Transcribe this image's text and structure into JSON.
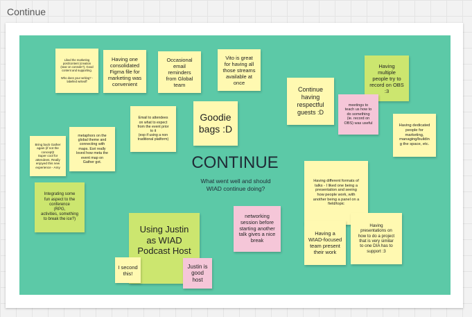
{
  "frame": {
    "title": "Continue"
  },
  "center": {
    "title": "CONTINUE",
    "subtitle": "What went well and should\nWIAD continue doing?"
  },
  "notes": {
    "marketing_post": "Liked the marketing\npost/content (creation\n(sear on console?), Good\ncontent and supporting.\n\nWho does your writing? -\nlabelled writeoff",
    "figma_file": "Having one\nconsolidated\nFigma file for\nmarketing was\nconvenient",
    "email_reminders": "Occasional\nemail\nreminders\nfrom Global\nteam",
    "vito": "Vito is great\nfor having all\nthose streams\navailable at\nonce",
    "record_obs": "Having\nmultiple\npeople try to\nrecord on OBS\n:3",
    "respectful_guests": "Continue\nhaving\nrespectful\nguests :D",
    "meetings_teach": "meetings to\nteach us how to\ndo something\n(ie. record on\nOBS) was useful",
    "email_attendees": "Email to attendees\non what to expect\nfrom the event prior\nto it\n(esp if using a non\ntraditional platform)",
    "goodie_bags": "Goodie\nbags :D",
    "dedicated_people": "Having dedicated\npeople for\nmarketing,\nmanaging/buildin\ng the space, etc.",
    "gather_again": "Bring back Gather\nagain (if not the\nconcept)!\nSuper cool for\nattendees. Really\nenjoyed this new\nexperience - Amy",
    "metaphors": "metaphors on the\nglobal theme and\nconnecting with\nmaps. Esri really\nloved how meta the\nevent map on\nGather got.",
    "fun_aspect": "Integrating some\nfun aspect to the\nconference\n(RPG,\nactivities, something\nto break the ice?)",
    "formats_talks": "Having different formats of\ntalks - I liked one being a\npresentation and seeing\nhow people work, with\nanother being a panel on a\nfield/topic",
    "networking": "networking\nsession before\nstarting another\ntalk gives a nice\nbreak",
    "justin_host": "Using Justin\nas WIAD\nPodcast Host",
    "second_this": "I second\nthis!",
    "justin_good": "Justin is\ngood\nhost",
    "wiad_team": "Having a\nWIAD-focused\nteam present\ntheir work",
    "project_presentations": "Having\npresentations on\nhow to do a project\nthat is very similar\nto one DIA has to\nsupport :3"
  },
  "colors": {
    "board": "#5cc9a7",
    "yellow": "#fff9b1",
    "pink": "#f5c6d8",
    "green": "#cce66f"
  }
}
